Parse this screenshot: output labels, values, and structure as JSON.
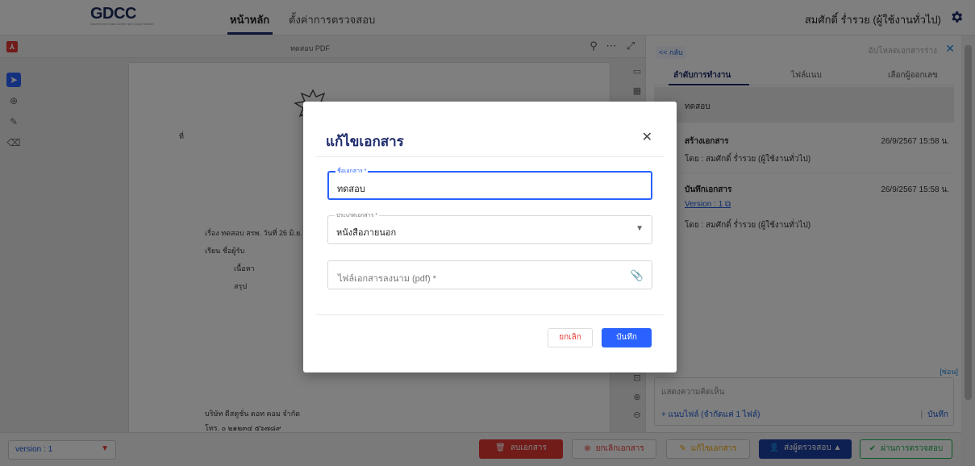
{
  "nav": {
    "logo": "GDCC",
    "logo_tagline": "Government Data Center and Cloud Service",
    "home": "หน้าหลัก",
    "settings": "ตั้งค่าการตรวจสอบ",
    "user": "สมศักดิ์ ร่ำรวย (ผู้ใช้งานทั่วไป)"
  },
  "doc_viewer": {
    "title": "ทดสอบ PDF",
    "page_lines": {
      "ref_no": "ที่",
      "subject": "เรื่อง  ทดสอบ สรพ. วันที่ 26 มิ.ย. 67 (1)",
      "to": "เรียน  ชื่อผู้รับ",
      "content": "เนื้อหา",
      "summary": "สรุป",
      "company": "บริษัท ดีสตูชั่น ดอท คอม จำกัด",
      "tel": "โทร. ๐ ๒๑๒๓๔ ๕๖๗๘๙"
    }
  },
  "right_panel": {
    "back": "<< กลับ",
    "upload": "อัปโหลดเอกสารร่าง",
    "tabs": [
      "ลำดับการทำงาน",
      "ไฟล์แนบ",
      "เลือกผู้ออกเลข"
    ],
    "flow_header": "ทดสอบ",
    "flow": [
      {
        "title": "สร้างเอกสาร",
        "date": "26/9/2567 15:58 น.",
        "by": "โดย : สมศักดิ์ ร่ำรวย (ผู้ใช้งานทั่วไป)"
      },
      {
        "title": "บันทึกเอกสาร",
        "date": "26/9/2567 15:58 น.",
        "link": "Version : 1",
        "by": "โดย : สมศักดิ์ ร่ำรวย (ผู้ใช้งานทั่วไป)"
      }
    ],
    "hide": "[ซ่อน]",
    "comment_placeholder": "แสดงความคิดเห็น",
    "attach": "แนบไฟล์ (จำกัดแค่ 1 ไฟล์)",
    "save": "บันทึก"
  },
  "bottom": {
    "version": "version : 1",
    "delete": "ลบเอกสาร",
    "cancel_doc": "ยกเลิกเอกสาร",
    "edit": "แก้ไขเอกสาร",
    "send": "ส่งผู้ตรวจสอบ",
    "pass": "ผ่านการตรวจสอบ"
  },
  "modal": {
    "title": "แก้ไขเอกสาร",
    "name_label": "ชื่อเอกสาร *",
    "name_value": "ทดสอบ",
    "type_label": "ประเภทเอกสาร *",
    "type_value": "หนังสือภายนอก",
    "file_placeholder": "ไฟล์เอกสารลงนาม (pdf) *",
    "cancel": "ยกเลิก",
    "save": "บันทึก"
  },
  "colors": {
    "primary": "#2962ff",
    "navy": "#1d2a6b",
    "danger": "#e53935",
    "warning": "#f6a500",
    "success": "#1eb04f"
  }
}
